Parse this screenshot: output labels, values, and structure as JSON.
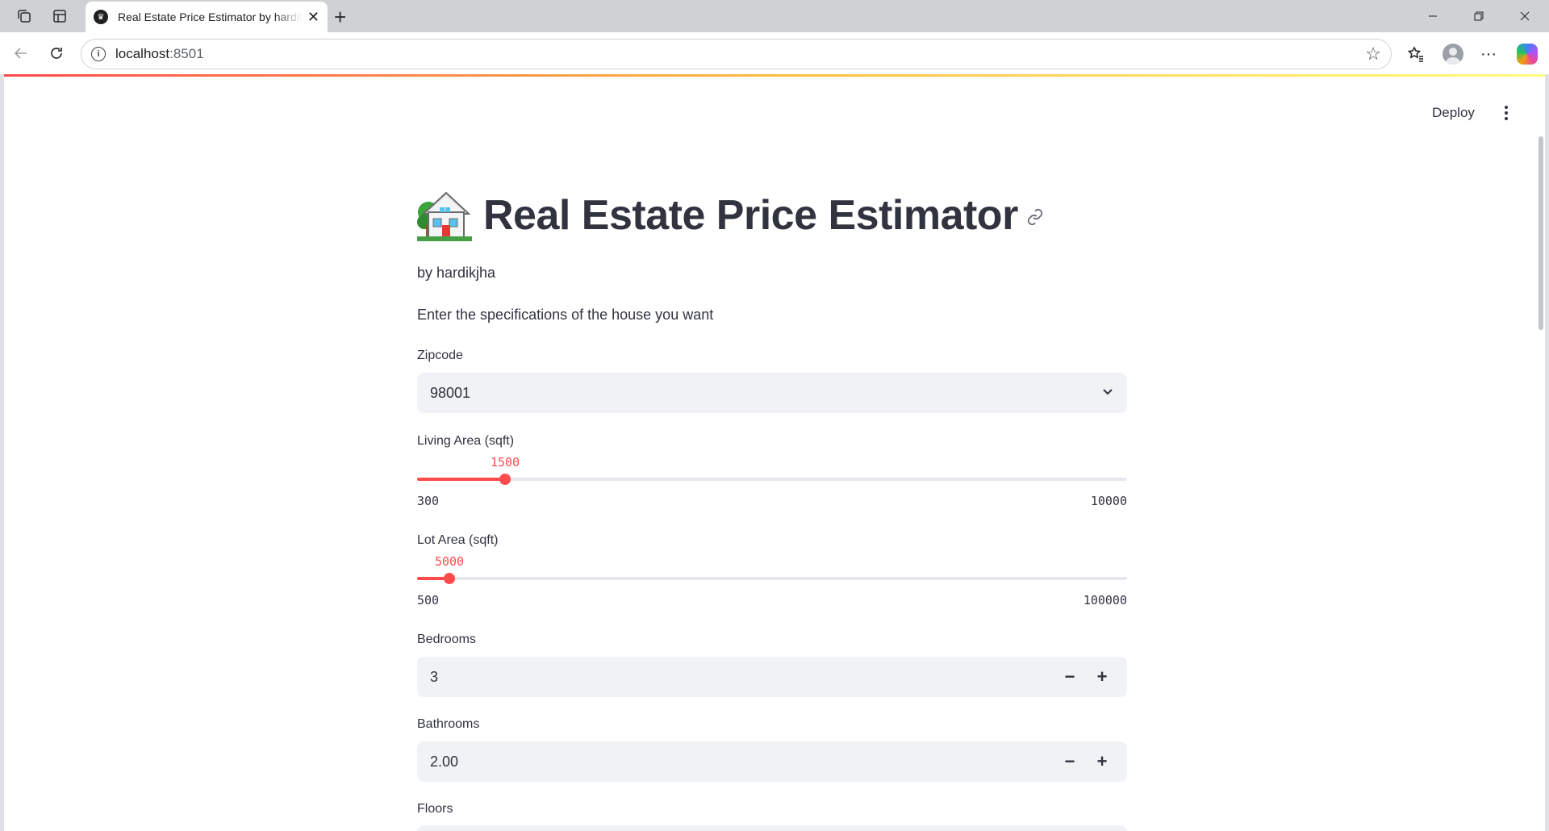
{
  "browser": {
    "tab_title": "Real Estate Price Estimator by hardikjha",
    "url_host": "localhost",
    "url_port": ":8501"
  },
  "header": {
    "deploy_label": "Deploy"
  },
  "main": {
    "title": "Real Estate Price Estimator",
    "title_emoji": "house-with-garden",
    "byline": "by hardikjha",
    "intro": "Enter the specifications of the house you want",
    "zipcode": {
      "label": "Zipcode",
      "value": "98001"
    },
    "living_area": {
      "label": "Living Area (sqft)",
      "value": "1500",
      "min": "300",
      "max": "10000",
      "fraction": 0.1237
    },
    "lot_area": {
      "label": "Lot Area (sqft)",
      "value": "5000",
      "min": "500",
      "max": "100000",
      "fraction": 0.0452
    },
    "bedrooms": {
      "label": "Bedrooms",
      "value": "3"
    },
    "bathrooms": {
      "label": "Bathrooms",
      "value": "2.00"
    },
    "floors": {
      "label": "Floors"
    }
  },
  "colors": {
    "accent": "#ff4b4b",
    "input_bg": "#f0f2f6",
    "text": "#31333f"
  }
}
